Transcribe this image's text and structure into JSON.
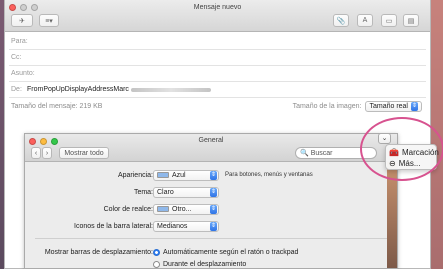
{
  "compose": {
    "title": "Mensaje nuevo",
    "fields": {
      "to_label": "Para:",
      "cc_label": "Cc:",
      "subject_label": "Asunto:",
      "from_label": "De:",
      "from_value": "FromPopUpDisplayAddressMarc"
    },
    "message_size": "Tamaño del mensaje: 219 KB",
    "image_size_label": "Tamaño de la imagen:",
    "image_size_value": "Tamaño real",
    "toolbar": {
      "list_button": "≡▾",
      "font_button": "A"
    }
  },
  "prefs": {
    "title": "General",
    "show_all": "Mostrar todo",
    "search_placeholder": "Buscar",
    "rows": {
      "appearance_label": "Apariencia:",
      "appearance_value": "Azul",
      "appearance_hint": "Para botones, menús y ventanas",
      "theme_label": "Tema:",
      "theme_value": "Claro",
      "highlight_label": "Color de realce:",
      "highlight_value": "Otro...",
      "sidebar_icons_label": "Iconos de la barra lateral:",
      "sidebar_icons_value": "Medianos"
    },
    "scrollbars_label": "Mostrar barras de desplazamiento:",
    "scroll_options": [
      "Automáticamente según el ratón o trackpad",
      "Durante el desplazamiento"
    ]
  },
  "markup_menu": {
    "items": [
      "Marcación",
      "Más..."
    ]
  },
  "colors": {
    "accent": "#2f74e6",
    "ring": "#d7528f",
    "swatch_blue": "#8fb8ea"
  }
}
